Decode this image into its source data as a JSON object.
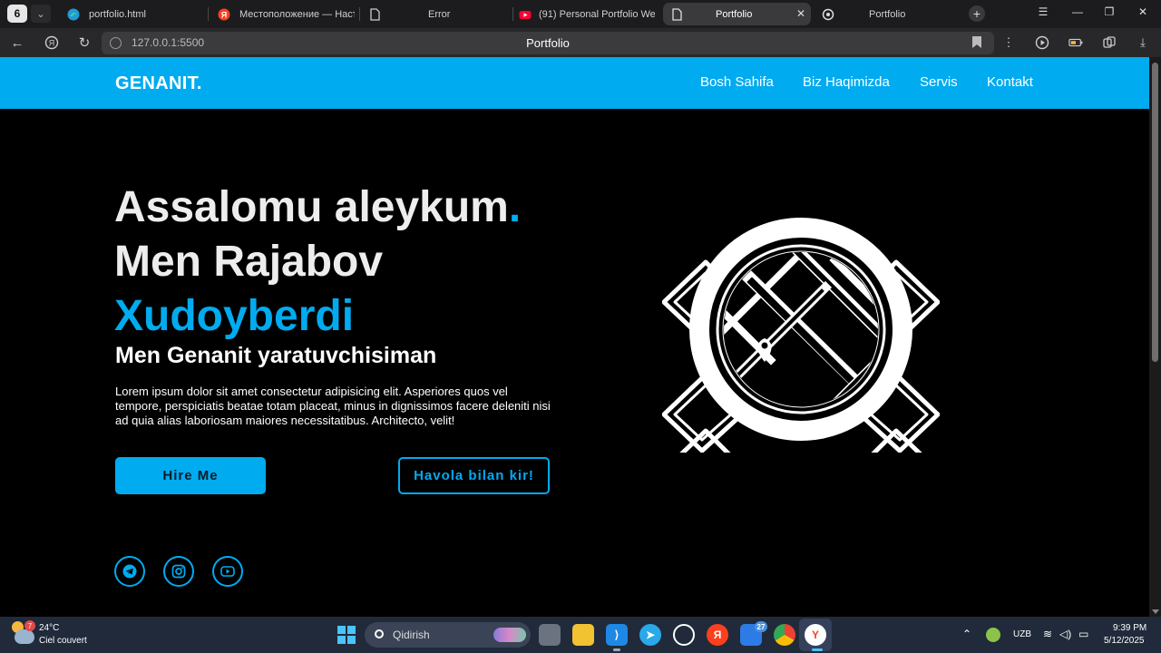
{
  "browser": {
    "tab_count": "6",
    "tabs": [
      {
        "label": "portfolio.html"
      },
      {
        "label": "Местоположение — Наст"
      },
      {
        "label": "Error"
      },
      {
        "label": "(91) Personal Portfolio We"
      },
      {
        "label": "Portfolio"
      },
      {
        "label": "Portfolio"
      }
    ],
    "url": "127.0.0.1:5500",
    "page_title": "Portfolio"
  },
  "site": {
    "logo": "GENANIT.",
    "nav": [
      "Bosh Sahifa",
      "Biz Haqimizda",
      "Servis",
      "Kontakt"
    ],
    "hero": {
      "greeting": "Assalomu aleykum",
      "greeting_dot": ".",
      "intro": "Men Rajabov",
      "name": "Xudoyberdi",
      "subtitle": "Men Genanit yaratuvchisiman",
      "description": "Lorem ipsum dolor sit amet consectetur adipisicing elit. Asperiores quos vel tempore, perspiciatis beatae totam placeat, minus in dignissimos facere deleniti nisi ad quia alias laboriosam maiores necessitatibus. Architecto, velit!",
      "btn_hire": "Hire Me",
      "btn_link": "Havola bilan kir!"
    },
    "socials": [
      "telegram-icon",
      "instagram-icon",
      "youtube-icon"
    ],
    "accent": "#00abf0"
  },
  "taskbar": {
    "weather_badge": "7",
    "temperature": "24°C",
    "weather": "Ciel couvert",
    "search_placeholder": "Qidirish",
    "badge_27": "27",
    "lang": "UZB",
    "time": "9:39 PM",
    "date": "5/12/2025"
  }
}
